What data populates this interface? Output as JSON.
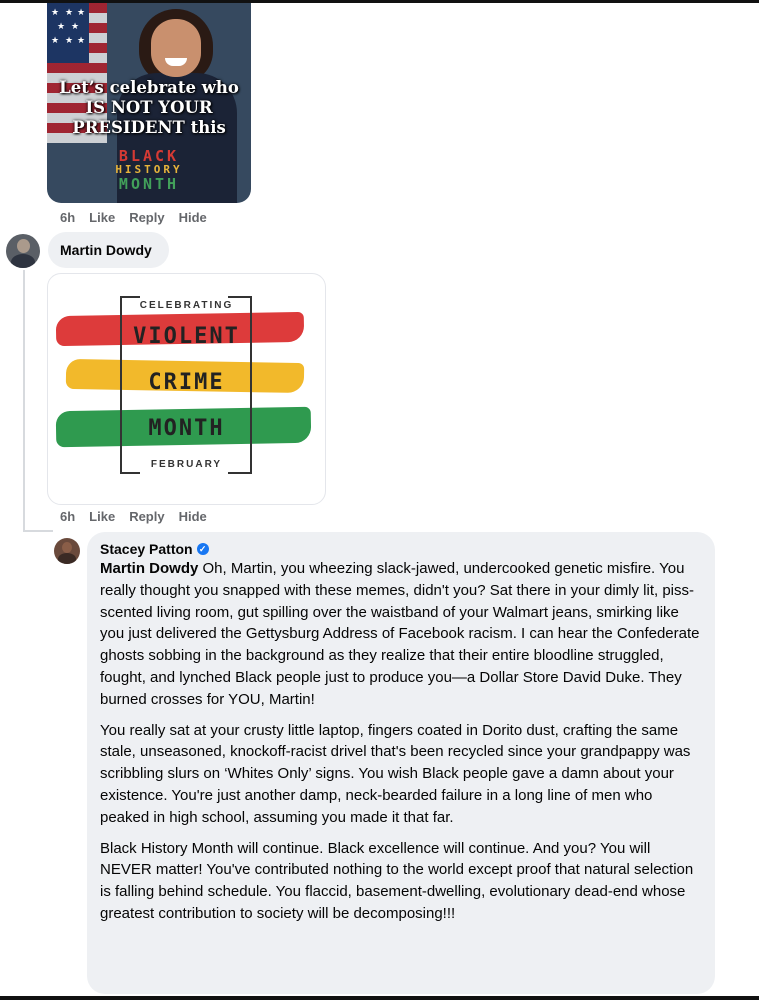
{
  "meme1": {
    "caption_line1": "Let’s celebrate who",
    "caption_line2": "IS NOT YOUR",
    "caption_line3": "PRESIDENT this",
    "bhm_black": "BLACK",
    "bhm_history": "HISTORY",
    "bhm_month": "MONTH"
  },
  "actions1": {
    "time": "6h",
    "like": "Like",
    "reply": "Reply",
    "hide": "Hide"
  },
  "reply_name": "Martin Dowdy",
  "meme2": {
    "top": "CELEBRATING",
    "line1": "VIOLENT",
    "line2": "CRIME",
    "line3": "MONTH",
    "bottom": "FEBRUARY",
    "colors": {
      "red": "#dd3b3b",
      "yellow": "#f2b92b",
      "green": "#2f9a4f"
    }
  },
  "actions2": {
    "time": "6h",
    "like": "Like",
    "reply": "Reply",
    "hide": "Hide"
  },
  "comment": {
    "author": "Stacey Patton",
    "mention": "Martin Dowdy",
    "p1": " Oh, Martin, you wheezing slack-jawed, undercooked genetic misfire. You really thought you snapped with these memes, didn't you? Sat there in your dimly lit, piss-scented living room, gut spilling over the waistband of your Walmart jeans, smirking like you just delivered the Gettysburg Address of Facebook racism. I can hear the Confederate ghosts sobbing in the background as they realize that their entire bloodline struggled, fought, and lynched Black people just to produce you—a Dollar Store David Duke. They burned crosses for YOU, Martin!",
    "p2": "You really sat at your crusty little laptop, fingers coated in Dorito dust, crafting the same stale, unseasoned, knockoff-racist drivel that's been recycled since your grandpappy was scribbling slurs on ‘Whites Only’ signs. You wish Black people gave a damn about your existence. You're just another damp, neck-bearded failure in a long line of men who peaked in high school, assuming you made it that far.",
    "p3": "Black History Month will continue. Black excellence will continue. And you? You will NEVER matter! You've contributed nothing to the world except proof that natural selection is falling behind schedule. You flaccid, basement-dwelling, evolutionary dead-end whose greatest contribution to society will be decomposing!!!"
  }
}
